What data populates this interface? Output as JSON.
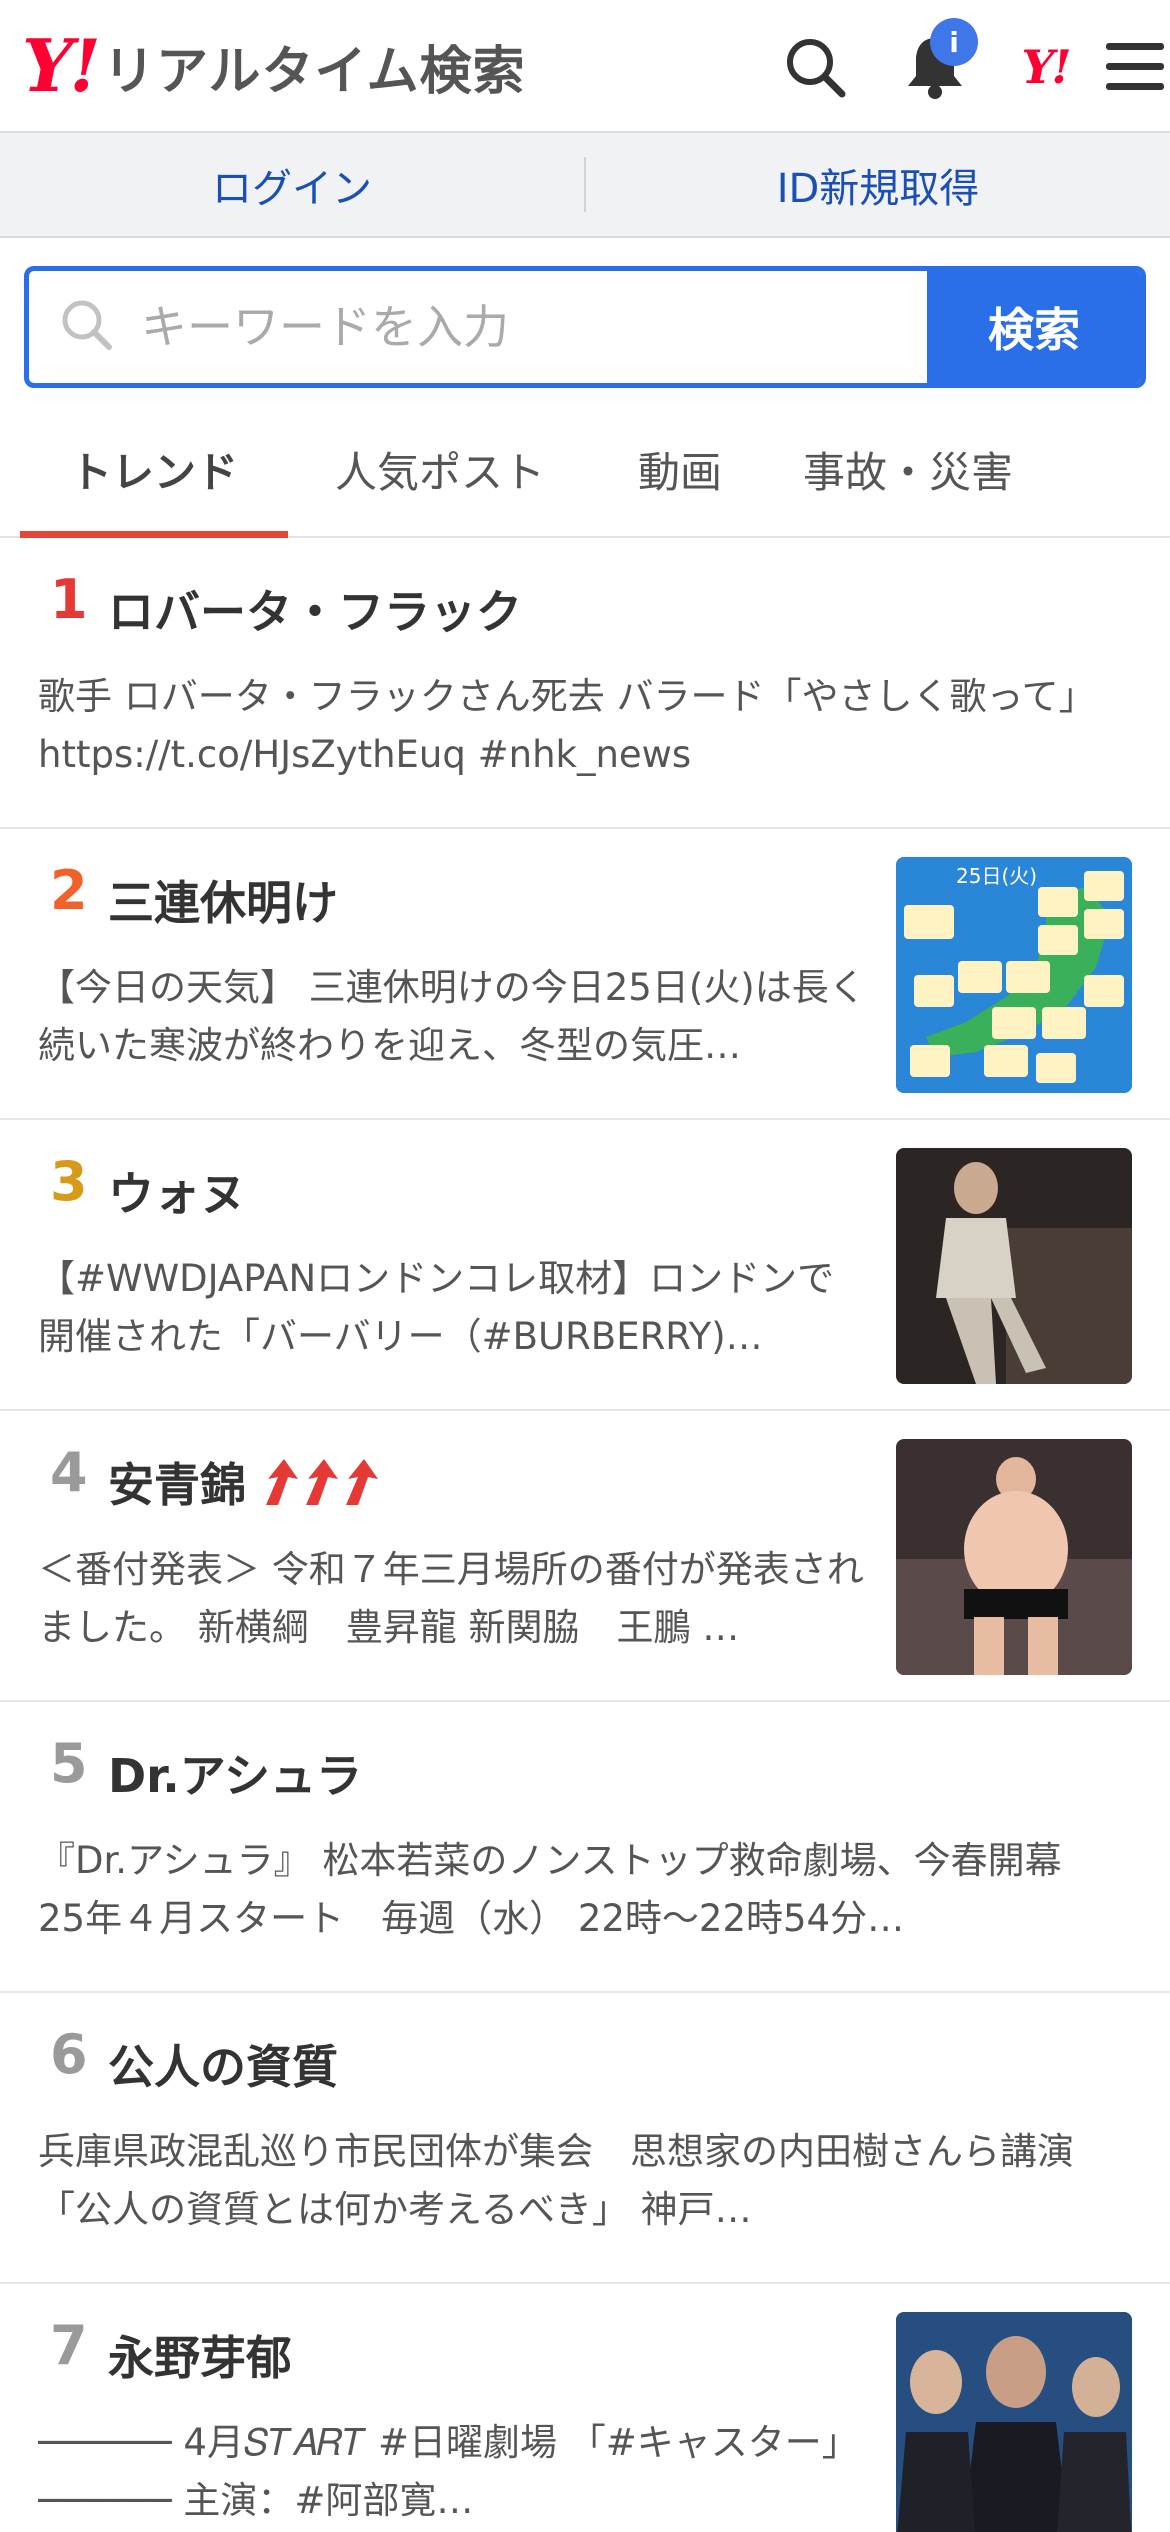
{
  "header": {
    "logo_mark": "Y!",
    "logo_title": "リアルタイム検索",
    "notification_badge": "i",
    "yj_mark": "Y!"
  },
  "login_bar": {
    "login_label": "ログイン",
    "register_label": "ID新規取得"
  },
  "search": {
    "placeholder": "キーワードを入力",
    "button_label": "検索"
  },
  "tabs": [
    {
      "label": "トレンド",
      "active": true
    },
    {
      "label": "人気ポスト",
      "active": false
    },
    {
      "label": "動画",
      "active": false
    },
    {
      "label": "事故・災害",
      "active": false
    }
  ],
  "trends": [
    {
      "rank": "1",
      "title": "ロバータ・フラック",
      "desc": "歌手 ロバータ・フラックさん死去 バラード「やさしく歌って」 https://t.co/HJsZythEuq #nhk_news"
    },
    {
      "rank": "2",
      "title": "三連休明け",
      "desc": "【今日の天気】 三連休明けの今日25日(火)は長く続いた寒波が終わりを迎え、冬型の気圧…",
      "thumb_caption": "25日(火)"
    },
    {
      "rank": "3",
      "title": "ウォヌ",
      "desc": "【#WWDJAPANロンドンコレ取材】ロンドンで開催された「バーバリー（#BURBERRY)…"
    },
    {
      "rank": "4",
      "title": "安青錦",
      "desc": "＜番付発表＞ 令和７年三月場所の番付が発表されました。 新横綱　豊昇龍 新関脇　王鵬 …",
      "rising_icon": "triple-up-arrow-icon"
    },
    {
      "rank": "5",
      "title": "Dr.アシュラ",
      "desc": "『Dr.アシュラ』 松本若菜のノンストップ救命劇場、今春開幕 25年４月スタート　毎週（水） 22時〜22時54分…"
    },
    {
      "rank": "6",
      "title": "公人の資質",
      "desc": "兵庫県政混乱巡り市民団体が集会　思想家の内田樹さんら講演「公人の資質とは何か考えるべき」 神戸…"
    },
    {
      "rank": "7",
      "title": "永野芽郁",
      "desc": "────── 4月𝑆𝑇𝐴𝑅𝑇 #日曜劇場 「#キャスター」 ────── 主演：#阿部寛…"
    }
  ],
  "colors": {
    "brand_red": "#ff0033",
    "accent_blue": "#2a6ee8",
    "tab_underline": "#e6463a",
    "rank1": "#e53935",
    "rank2": "#f0622a",
    "rank3": "#d79b1b",
    "rank_other": "#9a9a9a"
  }
}
